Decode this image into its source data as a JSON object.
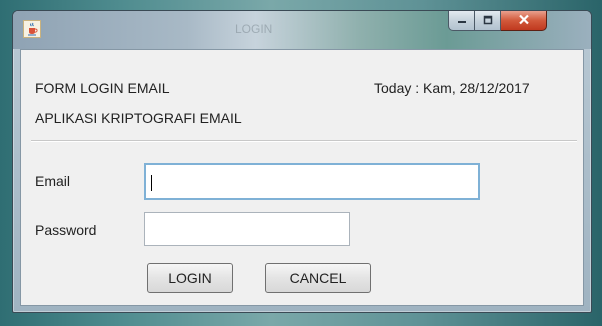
{
  "window": {
    "title": "LOGIN"
  },
  "header": {
    "form_title": "FORM LOGIN EMAIL",
    "app_name": "APLIKASI KRIPTOGRAFI EMAIL",
    "today_label": "Today : Kam, 28/12/2017"
  },
  "form": {
    "email_label": "Email",
    "email_value": "",
    "password_label": "Password",
    "password_value": ""
  },
  "buttons": {
    "login_label": "LOGIN",
    "cancel_label": "CANCEL"
  },
  "icons": {
    "app": "java-cup-icon",
    "minimize": "minimize-icon",
    "maximize": "maximize-icon",
    "close": "close-icon"
  },
  "colors": {
    "close_button": "#c0391f",
    "focus_border": "#7fb1d6",
    "window_background": "#f0f0f0"
  }
}
